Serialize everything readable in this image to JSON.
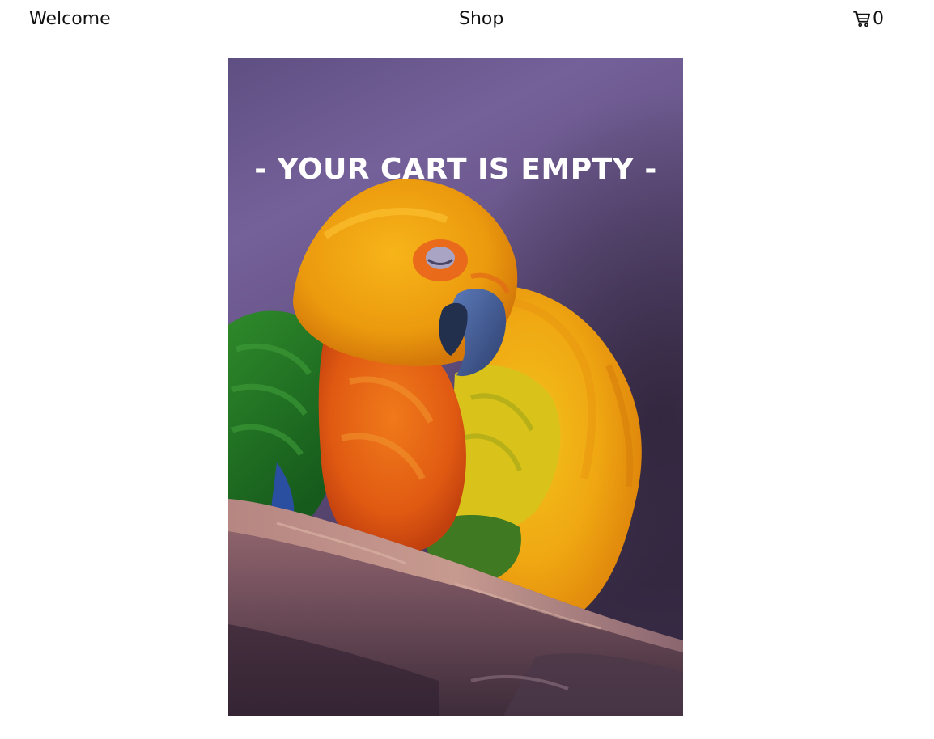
{
  "nav": {
    "welcome_label": "Welcome",
    "shop_label": "Shop",
    "cart_icon": "shopping-cart-icon",
    "cart_count": "0"
  },
  "hero": {
    "image": "sleeping-parrots-photo",
    "message": "- YOUR CART IS EMPTY -"
  },
  "colors": {
    "background": "#ffffff",
    "text": "#111111",
    "message_text": "#ffffff",
    "photo_backdrop": "#6e5b90"
  }
}
